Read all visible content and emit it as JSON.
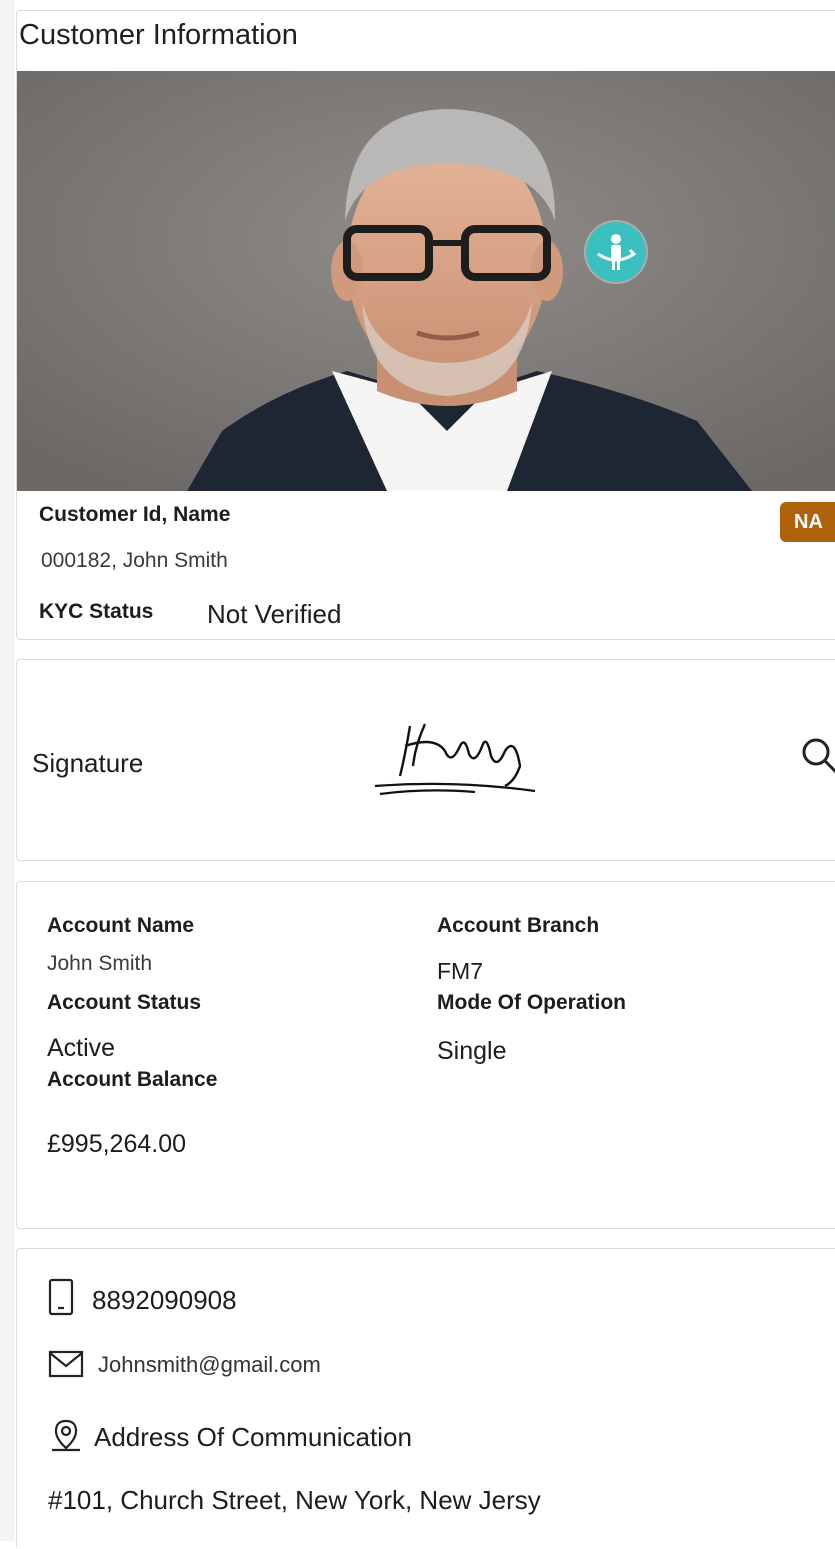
{
  "page": {
    "title": "Customer Information"
  },
  "customer": {
    "id_name_label": "Customer Id, Name",
    "id_name_value": "000182, John Smith",
    "kyc_label": "KYC Status",
    "kyc_value": "Not Verified",
    "badge": "NA"
  },
  "signature": {
    "label": "Signature"
  },
  "account": {
    "name_label": "Account Name",
    "name_value": "John Smith",
    "branch_label": "Account Branch",
    "branch_value": "FM7",
    "status_label": "Account Status",
    "status_value": "Active",
    "mode_label": "Mode Of Operation",
    "mode_value": "Single",
    "balance_label": "Account Balance",
    "balance_value": "£995,264.00"
  },
  "contact": {
    "phone": "8892090908",
    "email": "Johnsmith@gmail.com",
    "address_label": "Address Of Communication",
    "address": "#101, Church Street, New York, New Jersy"
  },
  "icons": {
    "photo_flip": "flip-person-icon",
    "signature_zoom": "search-icon",
    "phone": "mobile-phone-icon",
    "email": "mail-icon",
    "address": "location-pin-icon"
  },
  "colors": {
    "badge_bg": "#b0620a",
    "flip_icon_bg": "#3bbfbf"
  }
}
